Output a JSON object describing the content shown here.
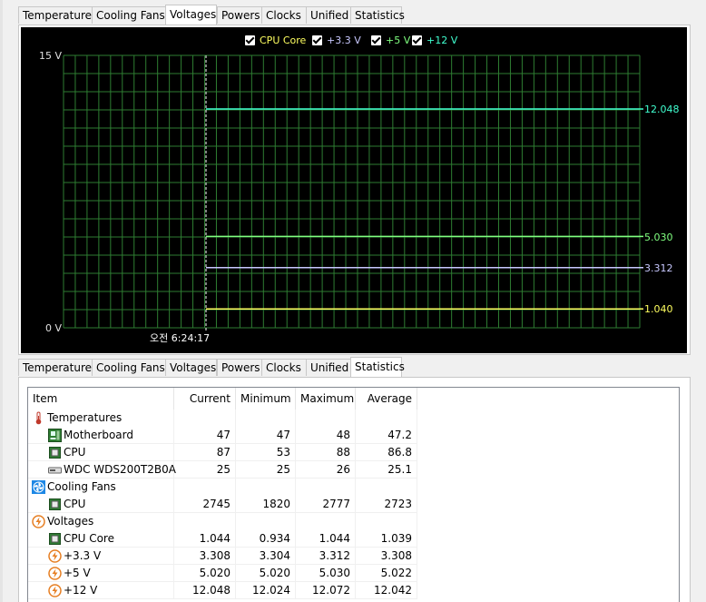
{
  "tabs": [
    "Temperatures",
    "Cooling Fans",
    "Voltages",
    "Powers",
    "Clocks",
    "Unified",
    "Statistics"
  ],
  "top_active_tab": "Voltages",
  "bottom_active_tab": "Statistics",
  "chart_data": {
    "type": "line",
    "ylim": [
      0,
      15
    ],
    "y_ticks": [
      "15 V",
      "0 V"
    ],
    "x_label": "오전 6:24:17",
    "series": [
      {
        "name": "CPU Core",
        "color": "#ffff60",
        "values": [
          1.04
        ]
      },
      {
        "name": "+3.3 V",
        "color": "#c8c8ff",
        "values": [
          3.312
        ]
      },
      {
        "name": "+5 V",
        "color": "#80ff80",
        "values": [
          5.03
        ]
      },
      {
        "name": "+12 V",
        "color": "#40ffd0",
        "values": [
          12.048
        ]
      }
    ],
    "value_labels": [
      "1.040",
      "3.312",
      "5.030",
      "12.048"
    ],
    "grid": true,
    "legend": "top-center"
  },
  "table": {
    "columns": [
      "Item",
      "Current",
      "Minimum",
      "Maximum",
      "Average"
    ],
    "rows": [
      {
        "type": "group",
        "label": "Temperatures",
        "icon": "thermometer-icon"
      },
      {
        "type": "item",
        "label": "Motherboard",
        "icon": "motherboard-icon",
        "values": [
          "47",
          "47",
          "48",
          "47.2"
        ]
      },
      {
        "type": "item",
        "label": "CPU",
        "icon": "cpu-chip-icon",
        "values": [
          "87",
          "53",
          "88",
          "86.8"
        ]
      },
      {
        "type": "item",
        "label": "WDC WDS200T2B0A",
        "icon": "drive-icon",
        "values": [
          "25",
          "25",
          "26",
          "25.1"
        ]
      },
      {
        "type": "group",
        "label": "Cooling Fans",
        "icon": "fan-icon"
      },
      {
        "type": "item",
        "label": "CPU",
        "icon": "cpu-chip-icon",
        "values": [
          "2745",
          "1820",
          "2777",
          "2723"
        ]
      },
      {
        "type": "group",
        "label": "Voltages",
        "icon": "voltage-icon"
      },
      {
        "type": "item",
        "label": "CPU Core",
        "icon": "cpu-chip-icon",
        "values": [
          "1.044",
          "0.934",
          "1.044",
          "1.039"
        ]
      },
      {
        "type": "item",
        "label": "+3.3 V",
        "icon": "voltage-icon",
        "values": [
          "3.308",
          "3.304",
          "3.312",
          "3.308"
        ]
      },
      {
        "type": "item",
        "label": "+5 V",
        "icon": "voltage-icon",
        "values": [
          "5.020",
          "5.020",
          "5.030",
          "5.022"
        ]
      },
      {
        "type": "item",
        "label": "+12 V",
        "icon": "voltage-icon",
        "values": [
          "12.048",
          "12.024",
          "12.072",
          "12.042"
        ]
      }
    ]
  }
}
